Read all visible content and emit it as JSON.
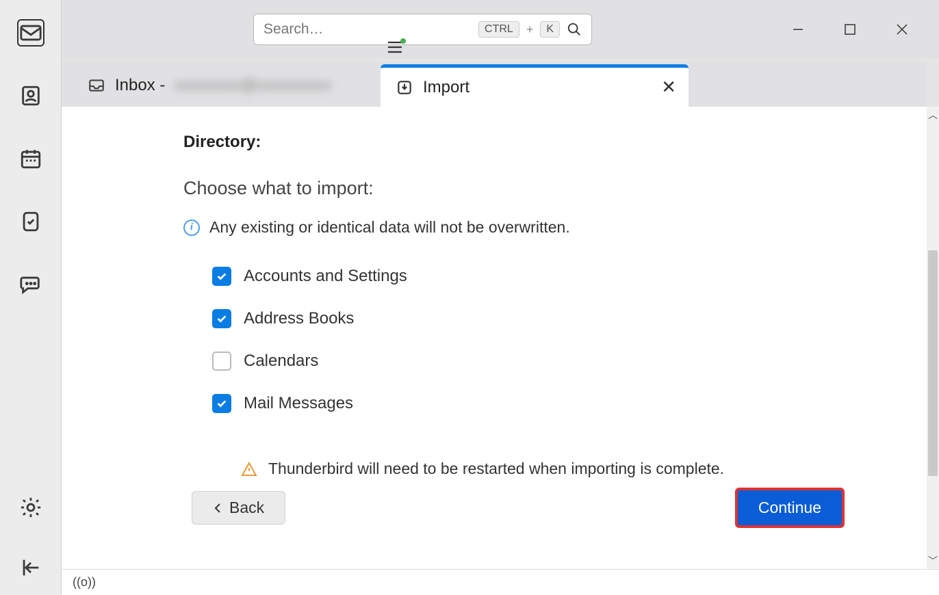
{
  "search": {
    "placeholder": "Search…",
    "kbd1": "CTRL",
    "kbd_plus": "+",
    "kbd2": "K"
  },
  "tabs": {
    "inbox_label": "Inbox -",
    "inbox_account": "xxxxxxxx@xxxxxxxxx",
    "import_label": "Import"
  },
  "panel": {
    "directory_label": "Directory:",
    "choose_label": "Choose what to import:",
    "info_text": "Any existing or identical data will not be overwritten.",
    "options": {
      "accounts": {
        "label": "Accounts and Settings",
        "checked": true
      },
      "address_books": {
        "label": "Address Books",
        "checked": true
      },
      "calendars": {
        "label": "Calendars",
        "checked": false
      },
      "mail": {
        "label": "Mail Messages",
        "checked": true
      }
    },
    "warn_text": "Thunderbird will need to be restarted when importing is complete."
  },
  "buttons": {
    "back": "Back",
    "continue": "Continue"
  },
  "statusbar": {
    "sync": "((o))"
  }
}
